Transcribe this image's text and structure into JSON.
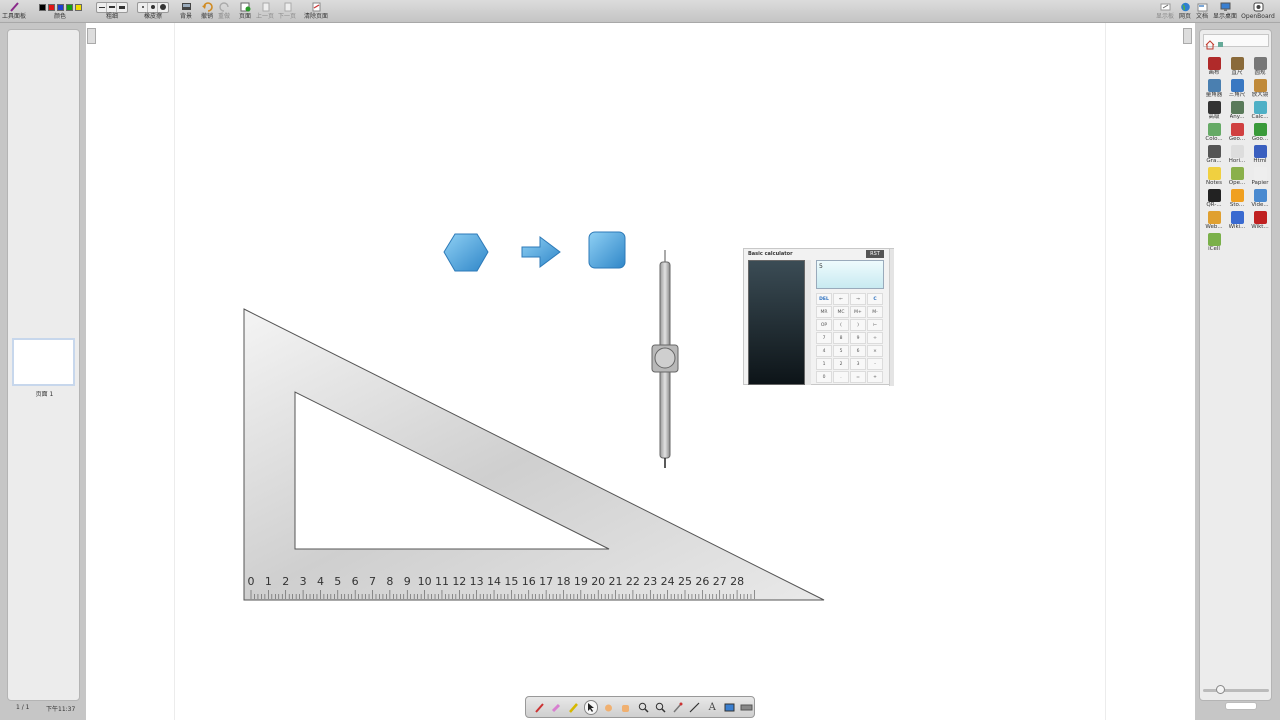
{
  "toolbar": {
    "tool_panel": "工具面板",
    "color": "颜色",
    "stroke": "粗细",
    "eraser_size": "橡皮擦",
    "background": "背景",
    "undo": "撤销",
    "redo": "重做",
    "page": "页面",
    "prev_page": "上一页",
    "next_page": "下一页",
    "clear_page": "清除页面",
    "show_board": "显示板",
    "web": "网页",
    "documents": "文档",
    "show_desktop": "显示桌面",
    "app": "OpenBoard",
    "colors": [
      "#000000",
      "#e01515",
      "#1e3fcf",
      "#12a012",
      "#f0dc00"
    ]
  },
  "pages": {
    "thumb_label": "页面 1",
    "page_count": "1 / 1",
    "clock": "下午11:37"
  },
  "ruler": {
    "labels": [
      "0",
      "1",
      "2",
      "3",
      "4",
      "5",
      "6",
      "7",
      "8",
      "9",
      "10",
      "11",
      "12",
      "13",
      "14",
      "15",
      "16",
      "17",
      "18",
      "19",
      "20",
      "21",
      "22",
      "23",
      "24",
      "25",
      "26",
      "27",
      "28"
    ]
  },
  "calculator": {
    "title": "Basic calculator",
    "reset": "RST",
    "display": "5",
    "keys": [
      "DEL",
      "←",
      "→",
      "C",
      "MR",
      "MC",
      "M+",
      "M-",
      "OP",
      "(",
      ")",
      "⊢",
      "7",
      "8",
      "9",
      "÷",
      "4",
      "5",
      "6",
      "×",
      "1",
      "2",
      "3",
      "-",
      "0",
      ".",
      "=",
      "+"
    ]
  },
  "library": {
    "items": [
      {
        "label": "画布",
        "color": "#b02a2a"
      },
      {
        "label": "直尺",
        "color": "#8a6a3a"
      },
      {
        "label": "圆规",
        "color": "#777777"
      },
      {
        "label": "量角器",
        "color": "#4a7fb0"
      },
      {
        "label": "三角尺",
        "color": "#3a78c2"
      },
      {
        "label": "放大镜",
        "color": "#c08a3a"
      },
      {
        "label": "高级",
        "color": "#333333"
      },
      {
        "label": "Any...",
        "color": "#5a7a5a"
      },
      {
        "label": "Calc...",
        "color": "#4fb0c6"
      },
      {
        "label": "Colo...",
        "color": "#66aa66"
      },
      {
        "label": "Geo...",
        "color": "#d04040"
      },
      {
        "label": "Goo...",
        "color": "#3a9a3a"
      },
      {
        "label": "Gra...",
        "color": "#555555"
      },
      {
        "label": "Hori...",
        "color": "#dddddd"
      },
      {
        "label": "Html",
        "color": "#3a5fbf"
      },
      {
        "label": "Notes",
        "color": "#f0d040"
      },
      {
        "label": "Ope...",
        "color": "#8ab04a"
      },
      {
        "label": "Papier",
        "color": "#eeeeee"
      },
      {
        "label": "QR-...",
        "color": "#222222"
      },
      {
        "label": "Sto...",
        "color": "#f0a020"
      },
      {
        "label": "Vide...",
        "color": "#4a8ad0"
      },
      {
        "label": "Web...",
        "color": "#e0a030"
      },
      {
        "label": "Wiki...",
        "color": "#3a6ad0"
      },
      {
        "label": "Wikt...",
        "color": "#c02020"
      },
      {
        "label": "iCell",
        "color": "#7ab04a"
      }
    ]
  }
}
